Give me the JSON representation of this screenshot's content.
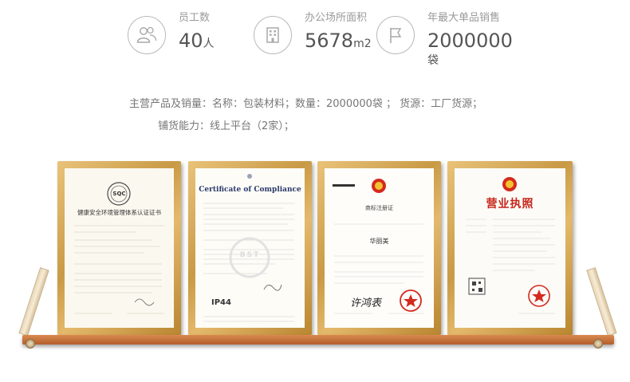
{
  "stats": [
    {
      "label": "员工数",
      "value": "40",
      "unit": "人",
      "icon": "group-icon"
    },
    {
      "label": "办公场所面积",
      "value": "5678",
      "unit": "m2",
      "icon": "building-icon"
    },
    {
      "label": "年最大单品销售",
      "value": "2000000",
      "unit": "袋",
      "icon": "flag-icon"
    }
  ],
  "info": {
    "products_key": "主营产品及销量：",
    "products_value": "名称：包装材料；数量：2000000袋 ； 货源：工厂货源；",
    "channel_key": "铺货能力：",
    "channel_value": "线上平台（2家）；"
  },
  "certificates": [
    {
      "logo": "SQC",
      "title": "健康安全环境管理体系认证证书"
    },
    {
      "logo": "BST",
      "title": "Certificate of Compliance",
      "footer": "IP44"
    },
    {
      "title": "商标注册证",
      "signature": "许鸿表"
    },
    {
      "title": "营业执照"
    }
  ]
}
